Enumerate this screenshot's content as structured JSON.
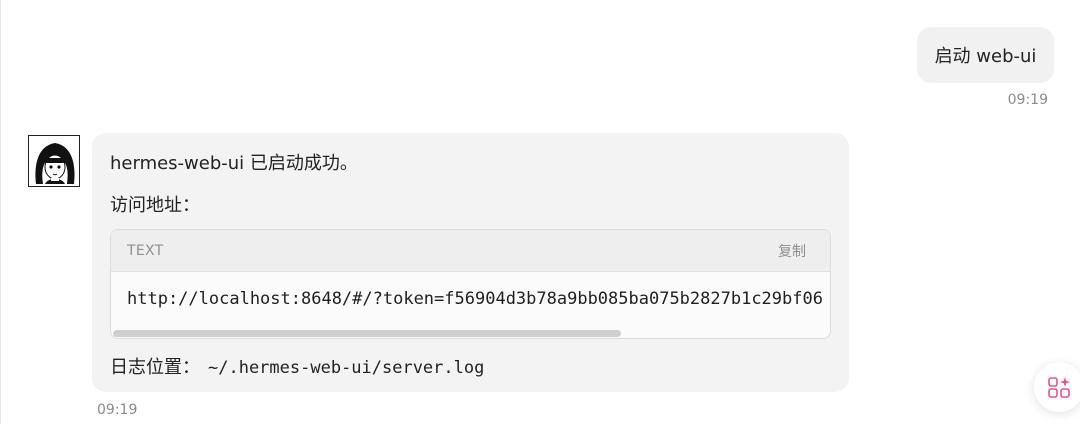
{
  "user_message": {
    "text": "启动 web-ui",
    "time": "09:19"
  },
  "assistant_message": {
    "line1": "hermes-web-ui 已启动成功。",
    "line2": "访问地址：",
    "code": {
      "language": "TEXT",
      "copy_label": "复制",
      "content": "http://localhost:8648/#/?token=f56904d3b78a9bb085ba075b2827b1c29bf06"
    },
    "log_label": "日志位置：",
    "log_path": "~/.hermes-web-ui/server.log",
    "time": "09:19"
  },
  "icons": {
    "avatar": "avatar-illustration",
    "fab": "apps-sparkle-icon"
  },
  "colors": {
    "bubble_bg": "#f1f1f1",
    "code_header_bg": "#eeeeee",
    "fab_icon": "#e6548a",
    "timestamp": "#8b8b8b"
  }
}
